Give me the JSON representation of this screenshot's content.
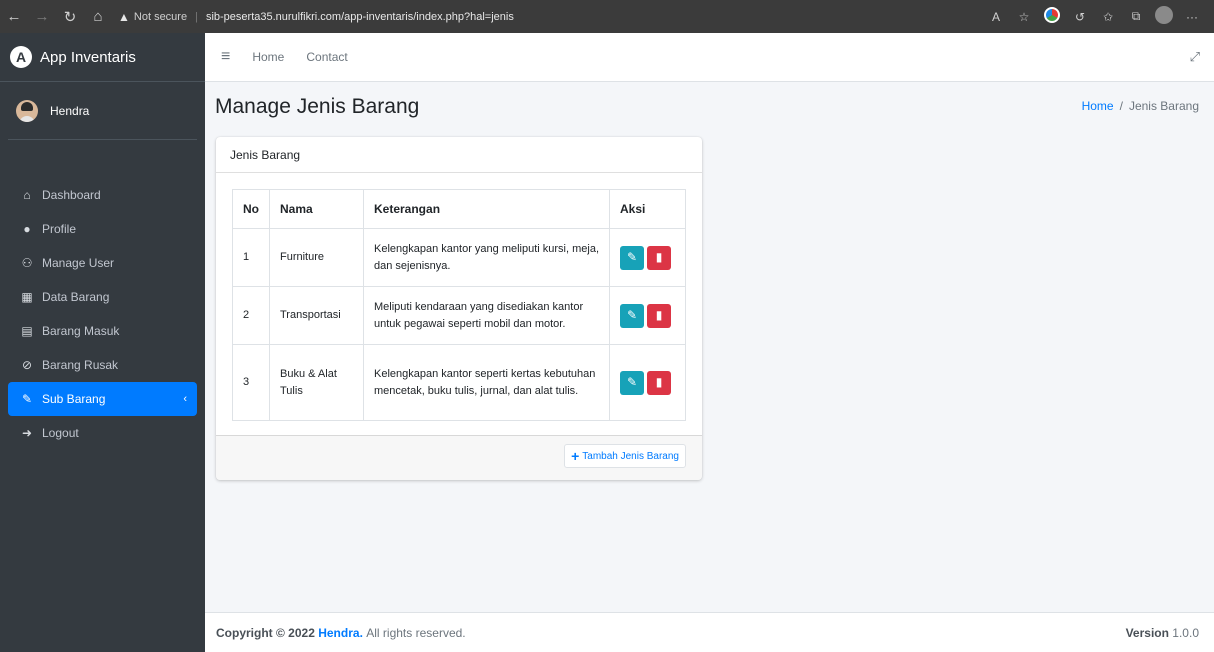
{
  "browser": {
    "security_label": "Not secure",
    "url": "sib-peserta35.nurulfikri.com/app-inventaris/index.php?hal=jenis"
  },
  "sidebar": {
    "brand": "App Inventaris",
    "user": "Hendra",
    "items": [
      {
        "label": "Dashboard",
        "icon": "home-icon"
      },
      {
        "label": "Profile",
        "icon": "user-icon"
      },
      {
        "label": "Manage User",
        "icon": "users-icon"
      },
      {
        "label": "Data Barang",
        "icon": "boxes-icon"
      },
      {
        "label": "Barang Masuk",
        "icon": "dolly-icon"
      },
      {
        "label": "Barang Rusak",
        "icon": "broken-truck-icon"
      },
      {
        "label": "Sub Barang",
        "icon": "edit-icon",
        "active": true
      },
      {
        "label": "Logout",
        "icon": "logout-icon"
      }
    ]
  },
  "topnav": {
    "home": "Home",
    "contact": "Contact"
  },
  "page": {
    "title": "Manage Jenis Barang",
    "breadcrumb_home": "Home",
    "breadcrumb_sep": "/",
    "breadcrumb_current": "Jenis Barang"
  },
  "card": {
    "header": "Jenis Barang",
    "columns": [
      "No",
      "Nama",
      "Keterangan",
      "Aksi"
    ],
    "rows": [
      {
        "no": "1",
        "nama": "Furniture",
        "keterangan": "Kelengkapan kantor yang meliputi kursi, meja, dan sejenisnya."
      },
      {
        "no": "2",
        "nama": "Transportasi",
        "keterangan": "Meliputi kendaraan yang disediakan kantor untuk pegawai seperti mobil dan motor."
      },
      {
        "no": "3",
        "nama": "Buku & Alat Tulis",
        "keterangan": "Kelengkapan kantor seperti kertas kebutuhan mencetak, buku tulis, jurnal, dan alat tulis."
      }
    ],
    "add_button": "Tambah Jenis Barang"
  },
  "footer": {
    "copyright_prefix": "Copyright © 2022",
    "author": "Hendra.",
    "suffix": "All rights reserved.",
    "version_label": "Version",
    "version": "1.0.0"
  },
  "colors": {
    "sidebar_bg": "#343a40",
    "active_item": "#007bff",
    "edit_button": "#17a2b8",
    "delete_button": "#dc3545"
  }
}
